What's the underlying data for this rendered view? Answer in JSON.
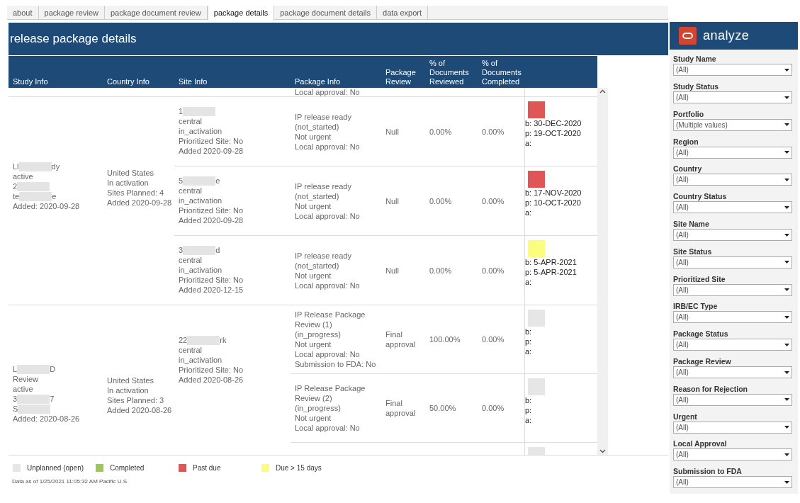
{
  "tabs": [
    {
      "label": "about",
      "selected": false
    },
    {
      "label": "package review",
      "selected": false
    },
    {
      "label": "package document review",
      "selected": false
    },
    {
      "label": "package details",
      "selected": true
    },
    {
      "label": "package document details",
      "selected": false
    },
    {
      "label": "data export",
      "selected": false
    }
  ],
  "title": "release package details",
  "columns": [
    "Study Info",
    "Country Info",
    "Site Info",
    "Package Info",
    "Package Review",
    "% of Documents Reviewed",
    "% of Documents Completed"
  ],
  "partial_top_line": "Local approval: No",
  "studies": [
    {
      "study_lines": [
        {
          "kind": "redacted",
          "before": "Ll",
          "after": "dy"
        },
        {
          "kind": "text",
          "text": "active"
        },
        {
          "kind": "redacted",
          "before": "2"
        },
        {
          "kind": "redacted",
          "before": "te",
          "after": "e"
        },
        {
          "kind": "text",
          "text": "Added: 2020-09-28"
        }
      ],
      "country_lines": [
        "United States",
        "In activation",
        "Sites Planned: 4",
        "Added 2020-09-28"
      ],
      "sites": [
        {
          "site_lines": [
            {
              "kind": "redacted",
              "before": "1"
            },
            {
              "kind": "text",
              "text": "central"
            },
            {
              "kind": "text",
              "text": "in_activation"
            },
            {
              "kind": "text",
              "text": "Prioritized Site: No"
            },
            {
              "kind": "text",
              "text": "Added 2020-09-28"
            }
          ],
          "packages": [
            {
              "info": [
                "IP release ready",
                "(not_started)",
                "Not urgent",
                "Local approval: No"
              ],
              "review": "Null",
              "reviewed": "0.00%",
              "completed": "0.00%",
              "color": "#e05555",
              "dates": [
                "b: 30-DEC-2020",
                "p: 19-OCT-2020",
                "a:"
              ]
            }
          ]
        },
        {
          "site_lines": [
            {
              "kind": "redacted",
              "before": "5",
              "after": "e"
            },
            {
              "kind": "text",
              "text": "central"
            },
            {
              "kind": "text",
              "text": "in_activation"
            },
            {
              "kind": "text",
              "text": "Prioritized Site: No"
            },
            {
              "kind": "text",
              "text": "Added 2020-09-28"
            }
          ],
          "packages": [
            {
              "info": [
                "IP release ready",
                "(not_started)",
                "Not urgent",
                "Local approval: No"
              ],
              "review": "Null",
              "reviewed": "0.00%",
              "completed": "0.00%",
              "color": "#e05555",
              "dates": [
                "b: 17-NOV-2020",
                "p: 10-OCT-2020",
                "a:"
              ]
            }
          ]
        },
        {
          "site_lines": [
            {
              "kind": "redacted",
              "before": "3",
              "after": "d"
            },
            {
              "kind": "text",
              "text": "central"
            },
            {
              "kind": "text",
              "text": "in_activation"
            },
            {
              "kind": "text",
              "text": "Prioritized Site: No"
            },
            {
              "kind": "text",
              "text": "Added 2020-12-15"
            }
          ],
          "packages": [
            {
              "info": [
                "IP release ready",
                "(not_started)",
                "Not urgent",
                "Local approval: No"
              ],
              "review": "Null",
              "reviewed": "0.00%",
              "completed": "0.00%",
              "color": "#fdfd7d",
              "dates": [
                "b: 5-APR-2021",
                "p: 5-APR-2021",
                "a:"
              ]
            }
          ]
        }
      ]
    },
    {
      "study_lines": [
        {
          "kind": "redacted",
          "before": "L",
          "after": "D"
        },
        {
          "kind": "text",
          "text": "Review"
        },
        {
          "kind": "text",
          "text": "active"
        },
        {
          "kind": "redacted",
          "before": "3",
          "after": "7"
        },
        {
          "kind": "redacted",
          "before": "S"
        },
        {
          "kind": "text",
          "text": "Added: 2020-08-26"
        }
      ],
      "country_lines": [
        "United States",
        "In activation",
        "Sites Planned: 3",
        "Added 2020-08-26"
      ],
      "sites": [
        {
          "site_lines": [
            {
              "kind": "redacted",
              "before": "22",
              "after": "rk"
            },
            {
              "kind": "text",
              "text": "central"
            },
            {
              "kind": "text",
              "text": "in_activation"
            },
            {
              "kind": "text",
              "text": "Prioritized Site: No"
            },
            {
              "kind": "text",
              "text": "Added 2020-08-26"
            }
          ],
          "packages": [
            {
              "info": [
                "IP Release Package",
                "Review (1)",
                "(in_progress)",
                "Not urgent",
                "Local approval: No",
                "Submission to FDA: No"
              ],
              "review": "Final approval",
              "reviewed": "100.00%",
              "completed": "0.00%",
              "color": "#e6e6e6",
              "dates": [
                "b:",
                "p:",
                "a:"
              ]
            },
            {
              "info": [
                "IP Release Package",
                "Review (2)",
                "(in_progress)",
                "Not urgent",
                "Local approval: No"
              ],
              "review": "Final approval",
              "reviewed": "50.00%",
              "completed": "0.00%",
              "color": "#e6e6e6",
              "dates": [
                "b:",
                "p:",
                "a:"
              ]
            },
            {
              "color": "#e6e6e6"
            }
          ]
        }
      ]
    }
  ],
  "legend": [
    {
      "label": "Unplanned (open)",
      "color": "#e6e6e6"
    },
    {
      "label": "Completed",
      "color": "#9bc957"
    },
    {
      "label": "Past due",
      "color": "#e05555"
    },
    {
      "label": "Due > 15 days",
      "color": "#fdfd7d"
    }
  ],
  "footnote": "Data as of 1/25/2021 11:05:32 AM Pacific U.S.",
  "brand": "analyze",
  "filters": [
    {
      "label": "Study Name",
      "value": "(All)"
    },
    {
      "label": "Study Status",
      "value": "(All)"
    },
    {
      "label": "Portfolio",
      "value": "(Multiple values)"
    },
    {
      "label": "Region",
      "value": "(All)"
    },
    {
      "label": "Country",
      "value": "(All)"
    },
    {
      "label": "Country Status",
      "value": "(All)"
    },
    {
      "label": "Site Name",
      "value": "(All)"
    },
    {
      "label": "Site Status",
      "value": "(All)"
    },
    {
      "label": "Prioritized Site",
      "value": "(All)"
    },
    {
      "label": "IRB/EC Type",
      "value": "(All)"
    },
    {
      "label": "Package Status",
      "value": "(All)"
    },
    {
      "label": "Package Review",
      "value": "(All)"
    },
    {
      "label": "Reason for Rejection",
      "value": "(All)"
    },
    {
      "label": "Urgent",
      "value": "(All)"
    },
    {
      "label": "Local Approval",
      "value": "(All)"
    },
    {
      "label": "Submission to FDA",
      "value": "(All)"
    }
  ]
}
